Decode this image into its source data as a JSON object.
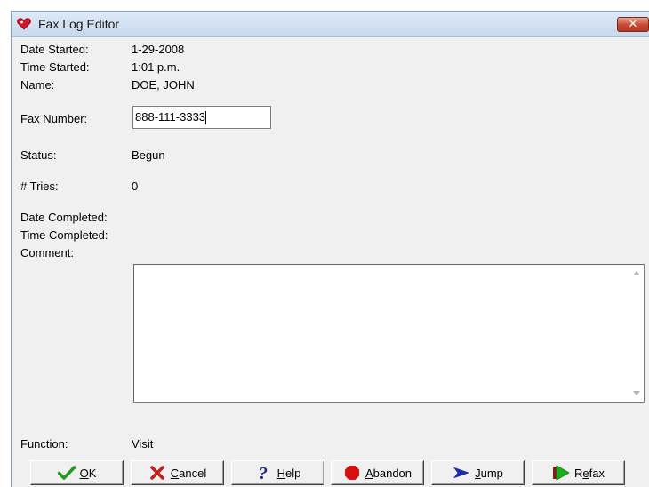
{
  "window": {
    "title": "Fax Log Editor",
    "close_glyph": "✕"
  },
  "fields": {
    "date_started": {
      "label": "Date Started:",
      "value": "1-29-2008"
    },
    "time_started": {
      "label": "Time Started:",
      "value": "1:01 p.m."
    },
    "name": {
      "label": "Name:",
      "value": "DOE, JOHN"
    },
    "fax_number": {
      "label_pre": "Fax ",
      "label_key": "N",
      "label_post": "umber:",
      "value": "888-111-3333"
    },
    "status": {
      "label": "Status:",
      "value": "Begun"
    },
    "tries": {
      "label": "# Tries:",
      "value": "0"
    },
    "date_completed": {
      "label": "Date Completed:",
      "value": ""
    },
    "time_completed": {
      "label": "Time Completed:",
      "value": ""
    },
    "comment": {
      "label": "Comment:",
      "value": ""
    },
    "function": {
      "label": "Function:",
      "value": "Visit"
    }
  },
  "buttons": {
    "ok": {
      "key": "O",
      "rest": "K",
      "icon": "checkmark-icon",
      "color": "#1f9c1f"
    },
    "cancel": {
      "key": "C",
      "rest": "ancel",
      "icon": "x-icon",
      "color": "#c0201a"
    },
    "help": {
      "key": "H",
      "rest": "elp",
      "icon": "question-mark-icon",
      "color": "#1a2a8c"
    },
    "abandon": {
      "pre": "",
      "key": "A",
      "rest": "bandon",
      "icon": "stop-sign-icon",
      "color": "#d81010"
    },
    "jump": {
      "key": "J",
      "rest": "ump",
      "icon": "arrow-right-icon",
      "color": "#1c2fa8"
    },
    "refax": {
      "pre": "R",
      "key": "e",
      "rest": "fax",
      "icon": "refax-icon",
      "color": "#18b018"
    }
  }
}
